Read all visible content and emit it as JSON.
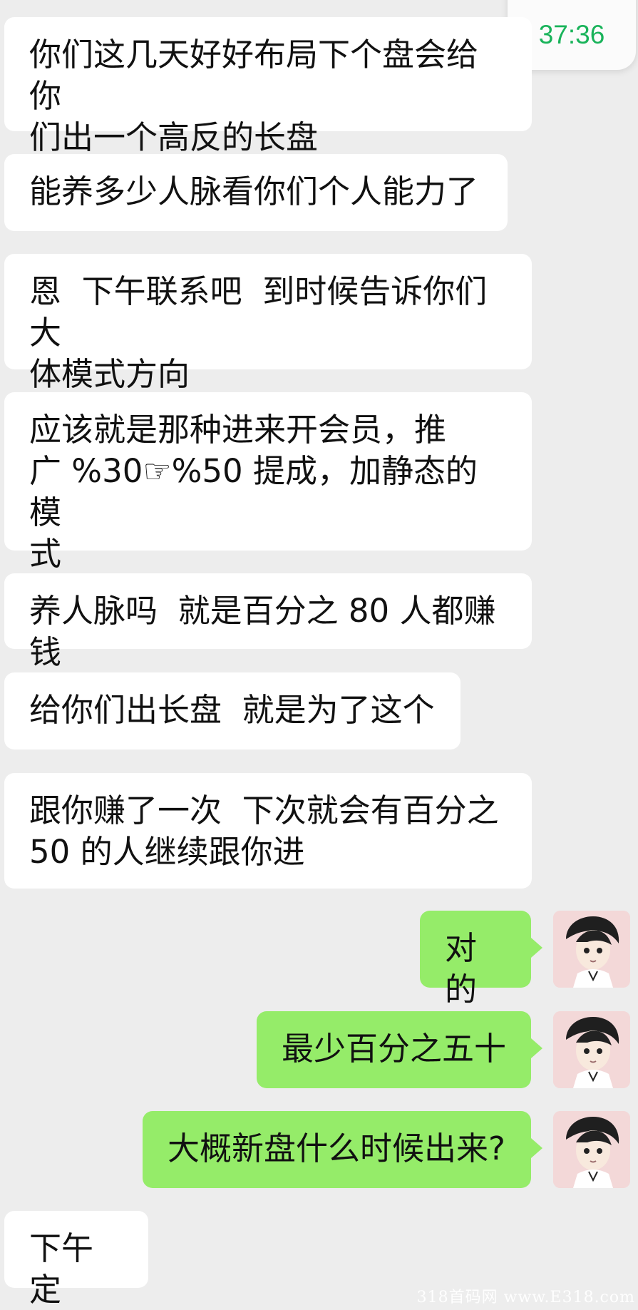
{
  "status": {
    "timer": "37:36"
  },
  "messages": [
    "你们这几天好好布局下个盘会给你\n们出一个高反的长盘",
    "能养多少人脉看你们个人能力了",
    "恩  下午联系吧  到时候告诉你们大\n体模式方向",
    "应该就是那种进来开会员，推\n广 %30☞%50 提成，加静态的模\n式",
    "养人脉吗  就是百分之 80 人都赚钱",
    "给你们出长盘  就是为了这个",
    "跟你赚了一次  下次就会有百分之\n50 的人继续跟你进",
    "对的",
    "最少百分之五十",
    "大概新盘什么时候出来?",
    "下午定"
  ],
  "watermark": "318首码网  www.E318.com",
  "colors": {
    "background": "#ededed",
    "incoming_bubble": "#ffffff",
    "outgoing_bubble": "#95ec69",
    "timer_text": "#19b35a"
  },
  "icons": {
    "avatar": "anime-boy-avatar-icon"
  }
}
